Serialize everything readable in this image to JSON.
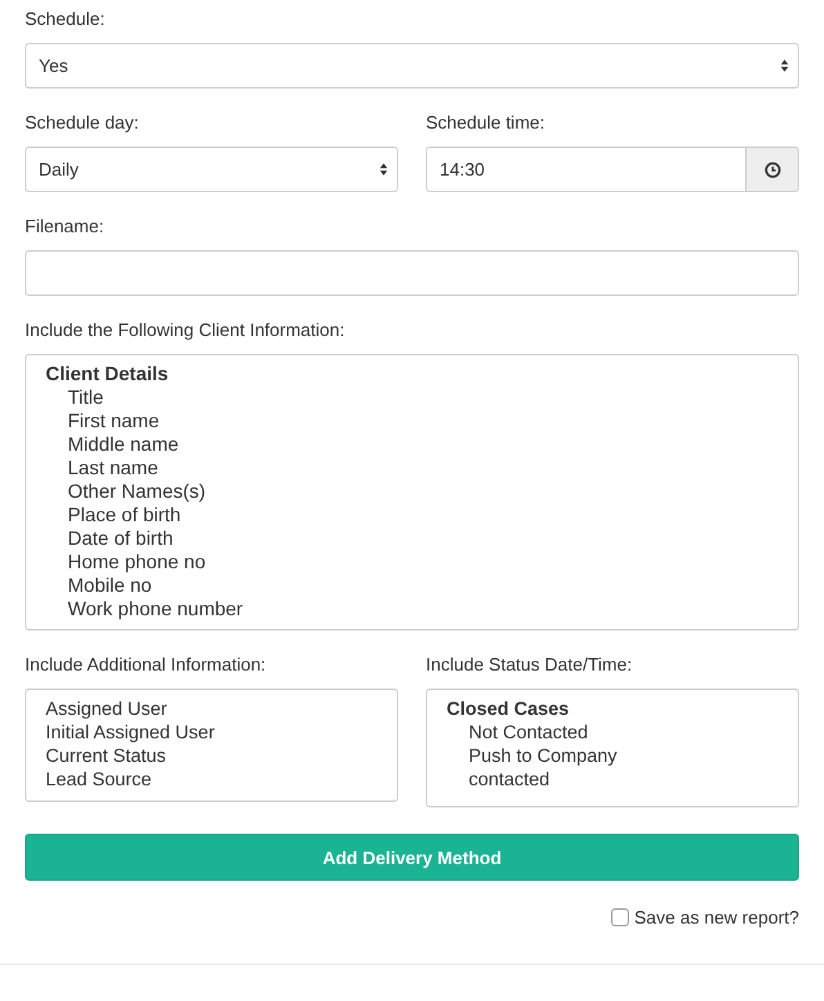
{
  "schedule": {
    "label": "Schedule:",
    "value": "Yes"
  },
  "schedule_day": {
    "label": "Schedule day:",
    "value": "Daily"
  },
  "schedule_time": {
    "label": "Schedule time:",
    "value": "14:30"
  },
  "filename": {
    "label": "Filename:"
  },
  "client_information": {
    "label": "Include the Following Client Information:",
    "groups": [
      {
        "label": "Client Details",
        "children": [
          "Title",
          "First name",
          "Middle name",
          "Last name",
          "Other Names(s)",
          "Place of birth",
          "Date of birth",
          "Home phone no",
          "Mobile no",
          "Work phone number"
        ]
      }
    ]
  },
  "additional_information": {
    "label": "Include Additional Information:",
    "items": [
      "Assigned User",
      "Initial Assigned User",
      "Current Status",
      "Lead Source"
    ]
  },
  "status_date_time": {
    "label": "Include Status Date/Time:",
    "groups": [
      {
        "label": "Closed Cases",
        "children": [
          "Not Contacted",
          "Push to Company",
          "contacted"
        ]
      }
    ]
  },
  "add_button": {
    "label": "Add Delivery Method"
  },
  "save_as_new": {
    "label": "Save as new report?",
    "checked": false
  }
}
